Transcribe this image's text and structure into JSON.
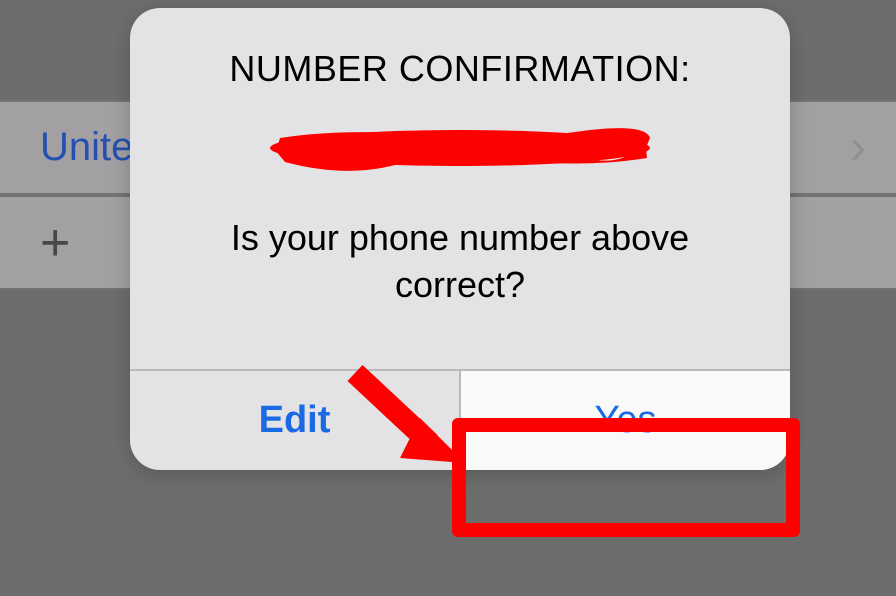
{
  "background": {
    "country_row": "Unite",
    "plus_symbol": "+"
  },
  "alert": {
    "title": "NUMBER CONFIRMATION:",
    "message": "Is your phone number above correct?",
    "buttons": {
      "edit": "Edit",
      "yes": "Yes"
    }
  }
}
